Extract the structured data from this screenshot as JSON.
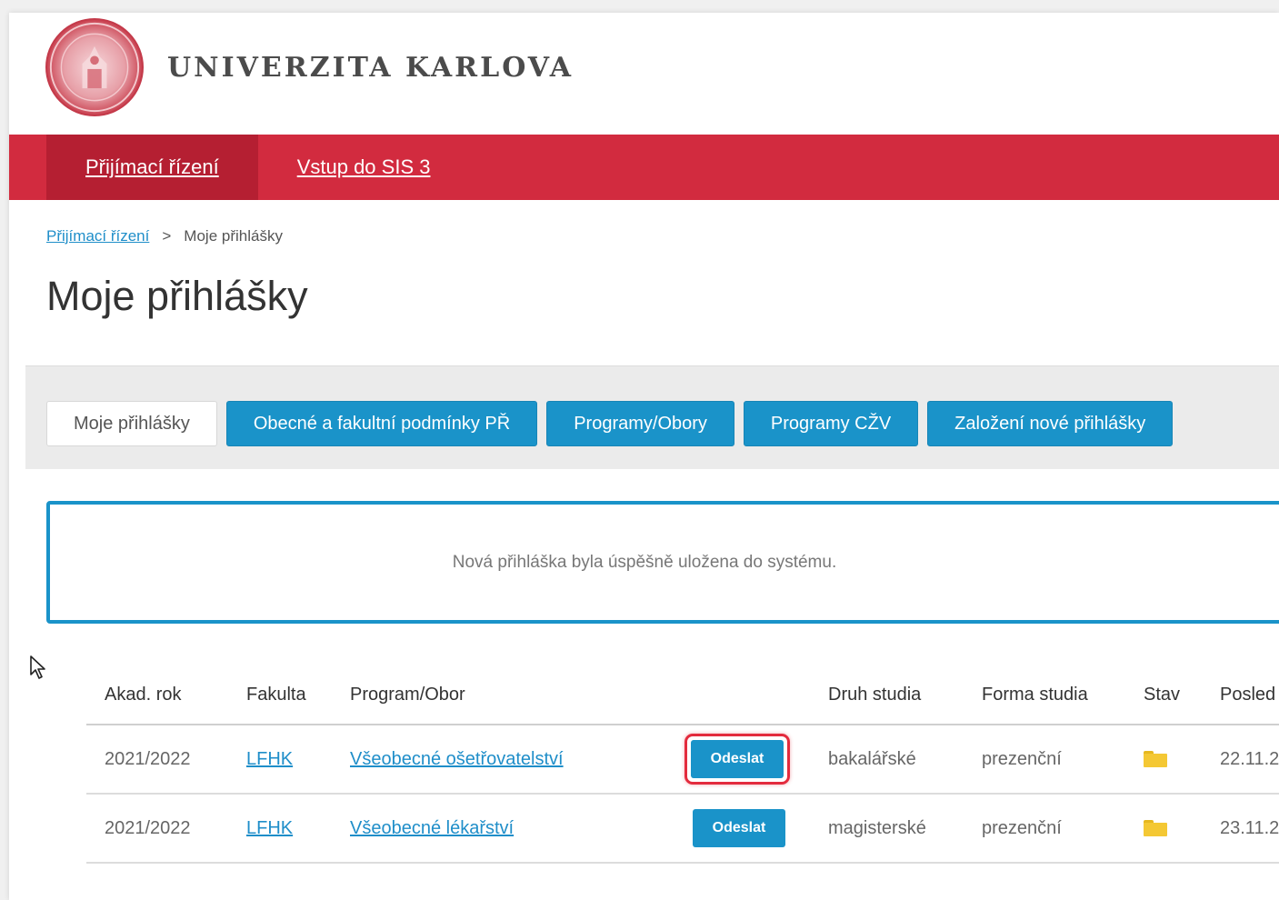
{
  "header": {
    "brand": "UNIVERZITA KARLOVA"
  },
  "nav": {
    "items": [
      "Přijímací řízení",
      "Vstup do SIS 3"
    ]
  },
  "breadcrumb": {
    "home": "Přijímací řízení",
    "separator": ">",
    "current": "Moje přihlášky"
  },
  "page": {
    "title": "Moje přihlášky"
  },
  "tabs": [
    "Moje přihlášky",
    "Obecné a fakultní podmínky PŘ",
    "Programy/Obory",
    "Programy CŽV",
    "Založení nové přihlášky"
  ],
  "alert": {
    "message": "Nová přihláška byla úspěšně uložena do systému."
  },
  "table": {
    "columns": [
      "Akad. rok",
      "Fakulta",
      "Program/Obor",
      "Druh studia",
      "Forma studia",
      "Stav",
      "Posled"
    ],
    "rows": [
      {
        "year": "2021/2022",
        "faculty": "LFHK",
        "program": "Všeobecné ošetřovatelství",
        "action": "Odeslat",
        "type": "bakalářské",
        "form": "prezenční",
        "status_icon": "folder-icon",
        "last": "22.11.2"
      },
      {
        "year": "2021/2022",
        "faculty": "LFHK",
        "program": "Všeobecné lékařství",
        "action": "Odeslat",
        "type": "magisterské",
        "form": "prezenční",
        "status_icon": "folder-icon",
        "last": "23.11.2"
      }
    ]
  },
  "colors": {
    "brand_red": "#d22b3f",
    "nav_active": "#b51f32",
    "accent_blue": "#1a93c9",
    "highlight_red": "#e32b3d",
    "folder_yellow": "#f4c834"
  }
}
